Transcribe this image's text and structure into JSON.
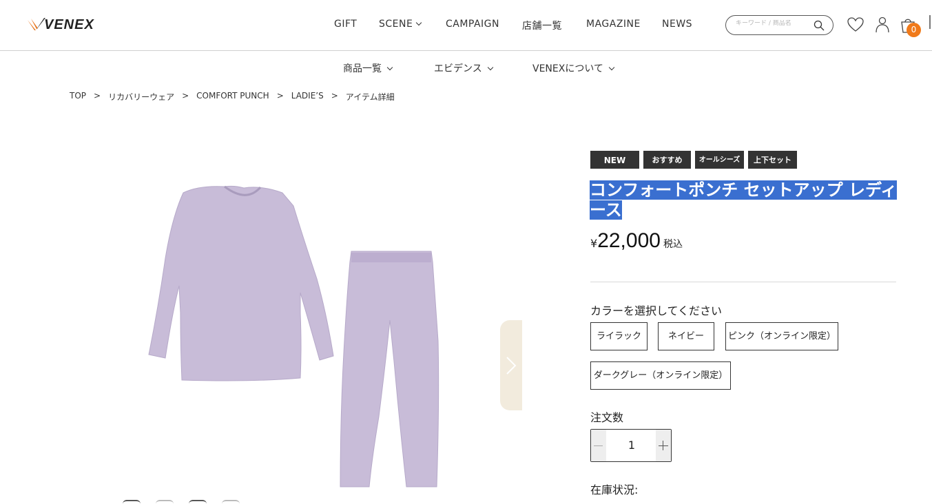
{
  "brand": {
    "name": "VENEX"
  },
  "header": {
    "nav": [
      "GIFT",
      "SCENE",
      "CAMPAIGN",
      "店舗一覧",
      "MAGAZINE",
      "NEWS"
    ],
    "search_placeholder": "キーワード / 商品名",
    "cart_count": "0"
  },
  "subnav": [
    "商品一覧",
    "エビデンス",
    "VENEXについて"
  ],
  "breadcrumb": [
    "TOP",
    "リカバリーウェア",
    "COMFORT PUNCH",
    "LADIE’S",
    "アイテム詳細"
  ],
  "breadcrumb_sep": ">",
  "product": {
    "tags": [
      "NEW",
      "おすすめ",
      "オールシーズン",
      "上下セット"
    ],
    "title": "コンフォートポンチ セットアップ レディース",
    "price_symbol": "¥",
    "price": "22,000",
    "tax_label": "税込",
    "color_label": "カラーを選択してください",
    "colors": [
      "ライラック",
      "ネイビー",
      "ピンク（オンライン限定）",
      "ダークグレー（オンライン限定）"
    ],
    "qty_label": "注文数",
    "qty_value": "1",
    "stock_label": "在庫状況:",
    "garment_color": "#c8bcd8"
  },
  "colors": {
    "accent": "#f07a1a",
    "selection": "#3a6fd0",
    "arrow_bg": "#f2ebdd"
  }
}
